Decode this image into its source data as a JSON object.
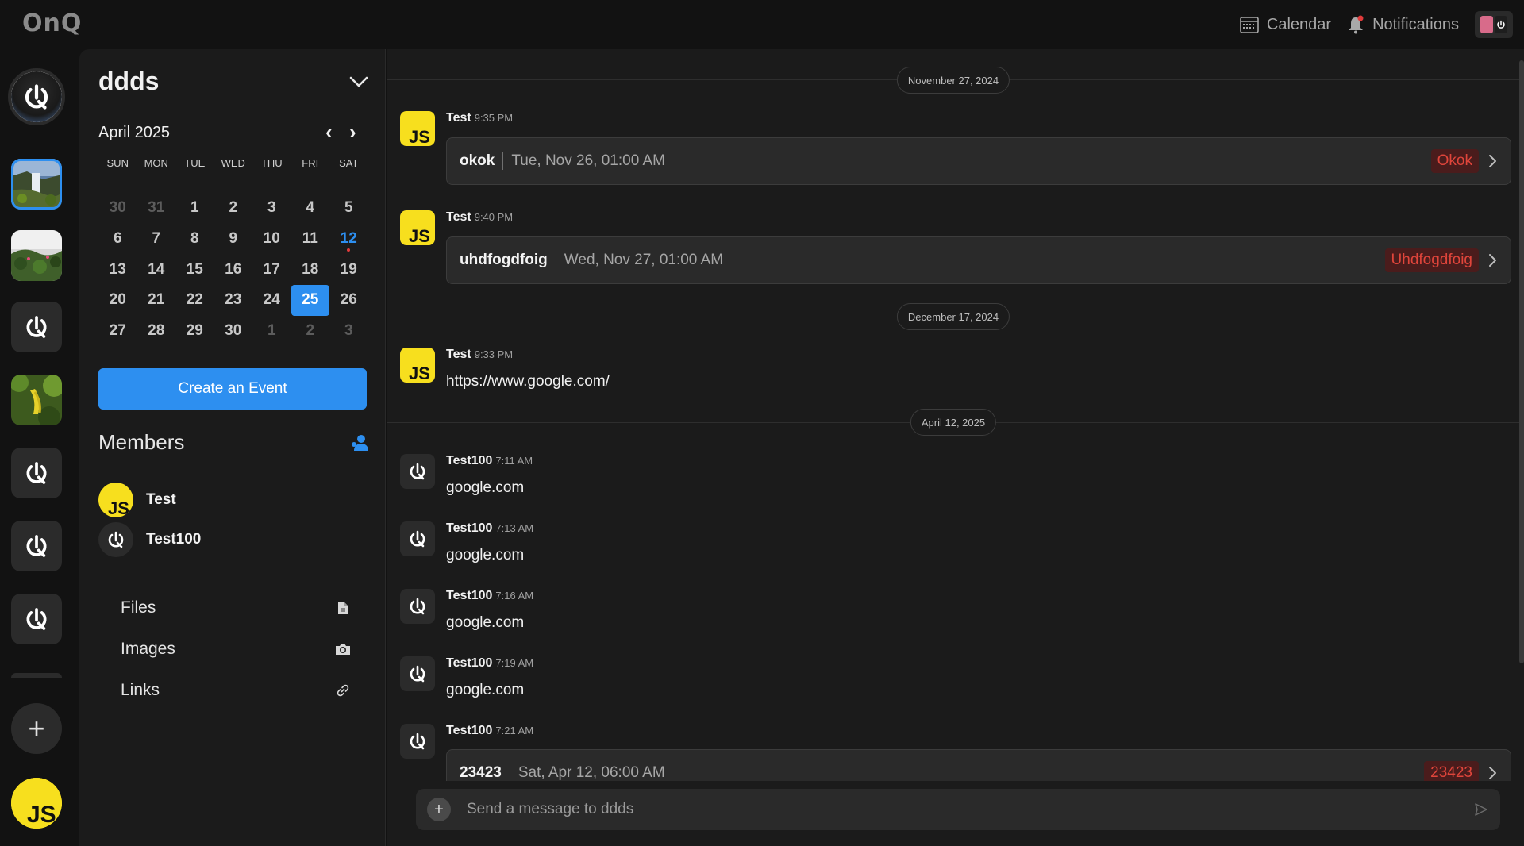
{
  "app": {
    "logo_text": "OnQ"
  },
  "topbar": {
    "calendar_label": "Calendar",
    "notifications_label": "Notifications"
  },
  "rail": {
    "items": [
      {
        "type": "logo",
        "label": "OnQ"
      },
      {
        "type": "photo",
        "label": "waterfall"
      },
      {
        "type": "photo",
        "label": "plants"
      },
      {
        "type": "logo",
        "label": "OnQ"
      },
      {
        "type": "photo",
        "label": "banana"
      },
      {
        "type": "logo",
        "label": "OnQ"
      },
      {
        "type": "logo",
        "label": "OnQ"
      },
      {
        "type": "logo",
        "label": "OnQ"
      }
    ],
    "add_label": "+"
  },
  "panel": {
    "title": "ddds",
    "calendar": {
      "month_label": "April 2025",
      "prev_label": "‹",
      "next_label": "›",
      "weekdays": [
        "SUN",
        "MON",
        "TUE",
        "WED",
        "THU",
        "FRI",
        "SAT"
      ],
      "days": [
        {
          "d": "30",
          "other": true
        },
        {
          "d": "31",
          "other": true
        },
        {
          "d": "1"
        },
        {
          "d": "2"
        },
        {
          "d": "3"
        },
        {
          "d": "4"
        },
        {
          "d": "5"
        },
        {
          "d": "6"
        },
        {
          "d": "7"
        },
        {
          "d": "8"
        },
        {
          "d": "9"
        },
        {
          "d": "10"
        },
        {
          "d": "11"
        },
        {
          "d": "12",
          "today": true
        },
        {
          "d": "13"
        },
        {
          "d": "14"
        },
        {
          "d": "15"
        },
        {
          "d": "16"
        },
        {
          "d": "17"
        },
        {
          "d": "18"
        },
        {
          "d": "19"
        },
        {
          "d": "20"
        },
        {
          "d": "21"
        },
        {
          "d": "22"
        },
        {
          "d": "23"
        },
        {
          "d": "24"
        },
        {
          "d": "25",
          "selected": true
        },
        {
          "d": "26"
        },
        {
          "d": "27"
        },
        {
          "d": "28"
        },
        {
          "d": "29"
        },
        {
          "d": "30"
        },
        {
          "d": "1",
          "other": true
        },
        {
          "d": "2",
          "other": true
        },
        {
          "d": "3",
          "other": true
        }
      ]
    },
    "create_event_label": "Create an Event",
    "members_title": "Members",
    "members": [
      {
        "name": "Test",
        "avatar": "js"
      },
      {
        "name": "Test100",
        "avatar": "onq"
      }
    ],
    "resources": [
      {
        "label": "Files",
        "icon": "file-icon"
      },
      {
        "label": "Images",
        "icon": "camera-icon"
      },
      {
        "label": "Links",
        "icon": "link-icon"
      }
    ]
  },
  "chat": {
    "date_separators": [
      "November 27, 2024",
      "December 17, 2024",
      "April 12, 2025"
    ],
    "messages": [
      {
        "author": "Test",
        "time": "9:35 PM",
        "avatar": "js",
        "event": {
          "name": "okok",
          "date": "Tue, Nov 26, 01:00 AM",
          "tag": "Okok"
        }
      },
      {
        "author": "Test",
        "time": "9:40 PM",
        "avatar": "js",
        "event": {
          "name": "uhdfogdfoig",
          "date": "Wed, Nov 27, 01:00 AM",
          "tag": "Uhdfogdfoig"
        }
      },
      {
        "author": "Test",
        "time": "9:33 PM",
        "avatar": "js",
        "text": "https://www.google.com/"
      },
      {
        "author": "Test100",
        "time": "7:11 AM",
        "avatar": "onq",
        "text": "google.com"
      },
      {
        "author": "Test100",
        "time": "7:13 AM",
        "avatar": "onq",
        "text": "google.com"
      },
      {
        "author": "Test100",
        "time": "7:16 AM",
        "avatar": "onq",
        "text": "google.com"
      },
      {
        "author": "Test100",
        "time": "7:19 AM",
        "avatar": "onq",
        "text": "google.com"
      },
      {
        "author": "Test100",
        "time": "7:21 AM",
        "avatar": "onq",
        "event": {
          "name": "23423",
          "date": "Sat, Apr 12, 06:00 AM",
          "tag": "23423"
        }
      }
    ],
    "composer_placeholder": "Send a message to ddds"
  },
  "colors": {
    "accent": "#2d8ff0",
    "js_yellow": "#f7df1e",
    "tag_red": "#e0453b",
    "background": "#121212",
    "panel": "#1b1b1b"
  }
}
